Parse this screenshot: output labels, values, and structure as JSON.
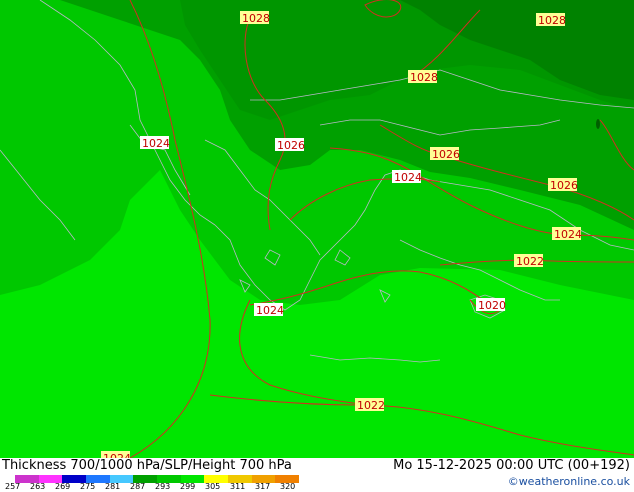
{
  "map": {
    "isobar_labels": [
      "1028",
      "1028",
      "1028",
      "1024",
      "1026",
      "1026",
      "1024",
      "1026",
      "1024",
      "1022",
      "1024",
      "1020",
      "1022",
      "1024"
    ]
  },
  "footer": {
    "title": "Thickness 700/1000 hPa/SLP/Height 700 hPa",
    "valid": "Mo 15-12-2025 00:00 UTC (00+192)",
    "credit": "©weatheronline.co.uk",
    "colorbar_ticks": [
      "257",
      "263",
      "269",
      "275",
      "281",
      "287",
      "293",
      "299",
      "305",
      "311",
      "317",
      "320"
    ],
    "colorbar_colors": [
      "#cc33cc",
      "#ff33ff",
      "#0000c8",
      "#1e78ff",
      "#46c8ff",
      "#00a000",
      "#00c800",
      "#00e600",
      "#ffff00",
      "#f0c800",
      "#f0a000",
      "#f08000"
    ]
  }
}
